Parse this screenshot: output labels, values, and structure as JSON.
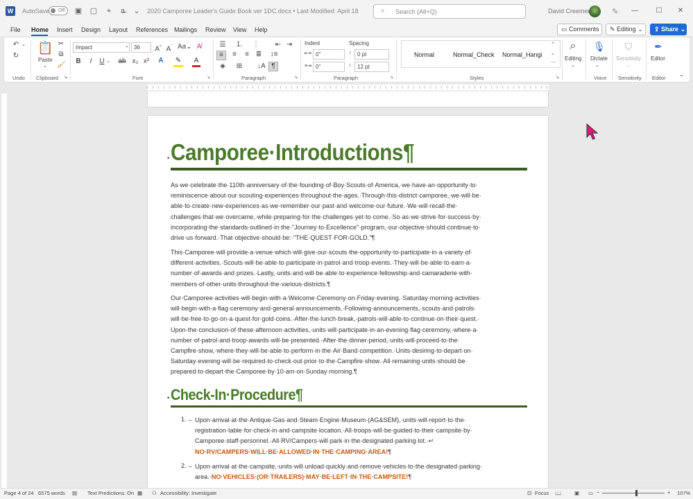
{
  "titlebar": {
    "app_logo": "W",
    "autosave_label": "AutoSave",
    "autosave_state": "Off",
    "doc_title": "2020 Camporee Leader's Guide Book ver 1DC.docx • Last Modified: April 18",
    "search_placeholder": "Search (Alt+Q)",
    "user_name": "David Creemer"
  },
  "menu": {
    "tabs": [
      "File",
      "Home",
      "Insert",
      "Design",
      "Layout",
      "References",
      "Mailings",
      "Review",
      "View",
      "Help"
    ],
    "active_tab": "Home",
    "comments_label": "Comments",
    "editing_label": "Editing",
    "share_label": "Share"
  },
  "ribbon": {
    "groups": {
      "undo": "Undo",
      "clipboard": "Clipboard",
      "font": "Font",
      "paragraph": "Paragraph",
      "paragraph2": "Paragraph",
      "styles": "Styles",
      "voice": "Voice",
      "sensitivity": "Sensitivity",
      "editor": "Editor"
    },
    "paste_label": "Paste",
    "font_name": "Impact",
    "font_size": "36",
    "indent_label": "Indent",
    "spacing_label": "Spacing",
    "indent_left": "0\"",
    "indent_right": "0\"",
    "spacing_before": "0 pt",
    "spacing_after": "12 pt",
    "styles": [
      "Normal",
      "Normal_Check",
      "Normal_Hangi"
    ],
    "editing_label": "Editing",
    "dictate_label": "Dictate",
    "sensitivity_label": "Sensitivity",
    "editor_label": "Editor"
  },
  "document": {
    "heading1": "Camporee·Introductions¶",
    "para1": [
      "As·we·celebrate·the·110th·anniversary·of·the·founding·of·Boy·Scouts·of·America,·we·have·an·opportunity·to·",
      "reminiscence·about·our·scouting·experiences·throughout·the·ages.·Through·this·district·camporee,·we·will·be·",
      "able·to·create·new·experiences·as·we·remember·our·past·and·welcome·our·future.·We·will·recall·the·",
      "challenges·that·we·overcame,·while·preparing·for·the·challenges·yet·to·come.·So·as·we·strive·for·success·by·",
      "incorporating·the·standards·outlined·in·the·\"Journey·to·Excellence\"·program,·our·objective·should·continue·to·",
      "drive·us·forward.·That·objective·should·be:·\"THE·QUEST·FOR·GOLD.\"¶"
    ],
    "para2": [
      "This·Camporee·will·provide·a·venue·which·will·give·our·scouts·the·opportunity·to·participate·in·a·variety·of·",
      "different·activities.·Scouts·will·be·able·to·participate·in·patrol·and·troop·events.·They·will·be·able·to·earn·a·",
      "number·of·awards·and·prizes.·Lastly,·units·and·will·be·able·to·experience·fellowship·and·camaraderie·with·",
      "members·of·other·units·throughout·the·various·districts.¶"
    ],
    "para3": [
      "Our·Camporee·activities·will·begin·with·a·Welcome·Ceremony·on·Friday·evening.·Saturday·morning·activities·",
      "will·begin·with·a·flag·ceremony·and·general·announcements.·Following·announcements,·scouts·and·patrols·",
      "will·be·free·to·go·on·a·quest·for·gold·coins.·After·the·lunch·break,·patrols·will·able·to·continue·on·their·quest.·",
      "Upon·the·conclusion·of·these·afternoon·activities,·units·will·participate·in·an·evening·flag·ceremony,·where·a·",
      "number·of·patrol·and·troop·awards·will·be·presented.·After·the·dinner·period,·units·will·proceed·to·the·",
      "Campfire·show,·where·they·will·be·able·to·perform·in·the·Air·Band·competition.·Units·desiring·to·depart·on·",
      "Saturday·evening·will·be·required·to·check·out·prior·to·the·Campfire·show.·All·remaining·units·should·be·",
      "prepared·to·depart·the·Camporee·by·10·am·on·Sunday·morning.¶"
    ],
    "heading2": "Check-In·Procedure¶",
    "list": [
      {
        "num": "1.→",
        "lines": [
          "Upon·arrival·at·the·Antique·Gas·and·Steam·Engine·Museum·(AG&SEM),·units·will·report·to·the·",
          "registration·table·for·check-in·and·campsite·location.·All·troops·will·be·guided·to·their·campsite·by·",
          "Camporee·staff·personnel.·All·RV/Campers·will·park·in·the·designated·parking·lot.·↵"
        ],
        "emphasis": "NO·RV/CAMPERS·WILL·BE·ALLOWED·IN·THE·CAMPING·AREA!",
        "emphasis_end": "¶"
      },
      {
        "num": "2.→",
        "lines": [
          "Upon·arrival·at·the·campsite,·units·will·unload·quickly·and·remove·vehicles·to·the·designated·parking·"
        ],
        "line2_prefix": "area.·",
        "emphasis": "NO·VEHICLES·(OR·TRAILERS)·MAY·BE·LEFT·IN·THE·CAMPSITE!",
        "emphasis_end": "¶"
      }
    ]
  },
  "statusbar": {
    "page": "Page 4 of 24",
    "words": "6575 words",
    "predictions": "Text Predictions: On",
    "accessibility": "Accessibility: Investigate",
    "focus": "Focus",
    "zoom": "107%"
  },
  "colors": {
    "heading": "#4a7a2a",
    "rule": "#3c5a25",
    "emphasis": "#c55a11",
    "share": "#1d6ad5",
    "cursor": "#e0197d"
  }
}
